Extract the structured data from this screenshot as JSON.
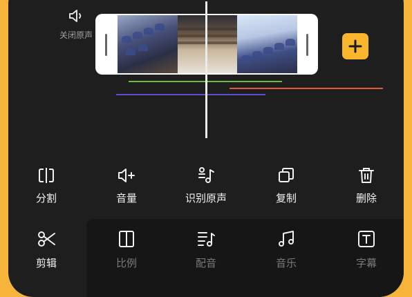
{
  "mute": {
    "label": "关闭原声",
    "icon": "speaker-icon"
  },
  "timeline": {
    "add_icon": "plus-icon"
  },
  "colors": {
    "background": "#f7b43a",
    "panel": "#1e1e1e",
    "accent": "#f9b52c",
    "track_green": "#6dbb3f",
    "track_orange": "#e4583a",
    "track_blue": "#5b4fd6"
  },
  "tools": [
    {
      "label": "分割",
      "icon": "split-icon"
    },
    {
      "label": "音量",
      "icon": "volume-plus-icon"
    },
    {
      "label": "识别原声",
      "icon": "music-note-icon"
    },
    {
      "label": "复制",
      "icon": "copy-icon"
    },
    {
      "label": "删除",
      "icon": "trash-icon"
    }
  ],
  "bottom_tabs": [
    {
      "label": "剪辑",
      "icon": "scissors-icon",
      "active": true
    },
    {
      "label": "比例",
      "icon": "ratio-icon",
      "active": false
    },
    {
      "label": "配音",
      "icon": "dubbing-icon",
      "active": false
    },
    {
      "label": "音乐",
      "icon": "music-icon",
      "active": false
    },
    {
      "label": "字幕",
      "icon": "text-icon",
      "active": false
    }
  ]
}
